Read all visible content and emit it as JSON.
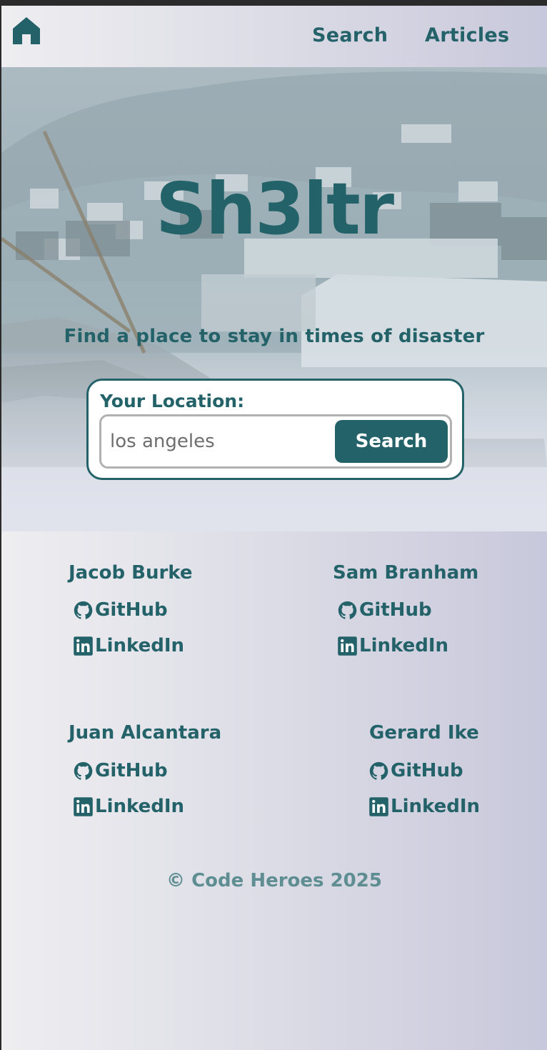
{
  "nav": {
    "home_icon": "home-icon",
    "links": [
      "Search",
      "Articles"
    ]
  },
  "hero": {
    "brand": "Sh3ltr",
    "tagline": "Find a place to stay in times of disaster",
    "search": {
      "label": "Your Location:",
      "value": "los angeles",
      "button": "Search"
    }
  },
  "team": [
    {
      "name": "Jacob Burke",
      "github": "GitHub",
      "linkedin": "LinkedIn"
    },
    {
      "name": "Sam Branham",
      "github": "GitHub",
      "linkedin": "LinkedIn"
    },
    {
      "name": "Juan Alcantara",
      "github": "GitHub",
      "linkedin": "LinkedIn"
    },
    {
      "name": "Gerard Ike",
      "github": "GitHub",
      "linkedin": "LinkedIn"
    }
  ],
  "footer": {
    "copyright": "© Code Heroes 2025"
  },
  "colors": {
    "accent": "#246269",
    "footer_text": "#5e8e92",
    "input_border": "#b1b1b1"
  }
}
